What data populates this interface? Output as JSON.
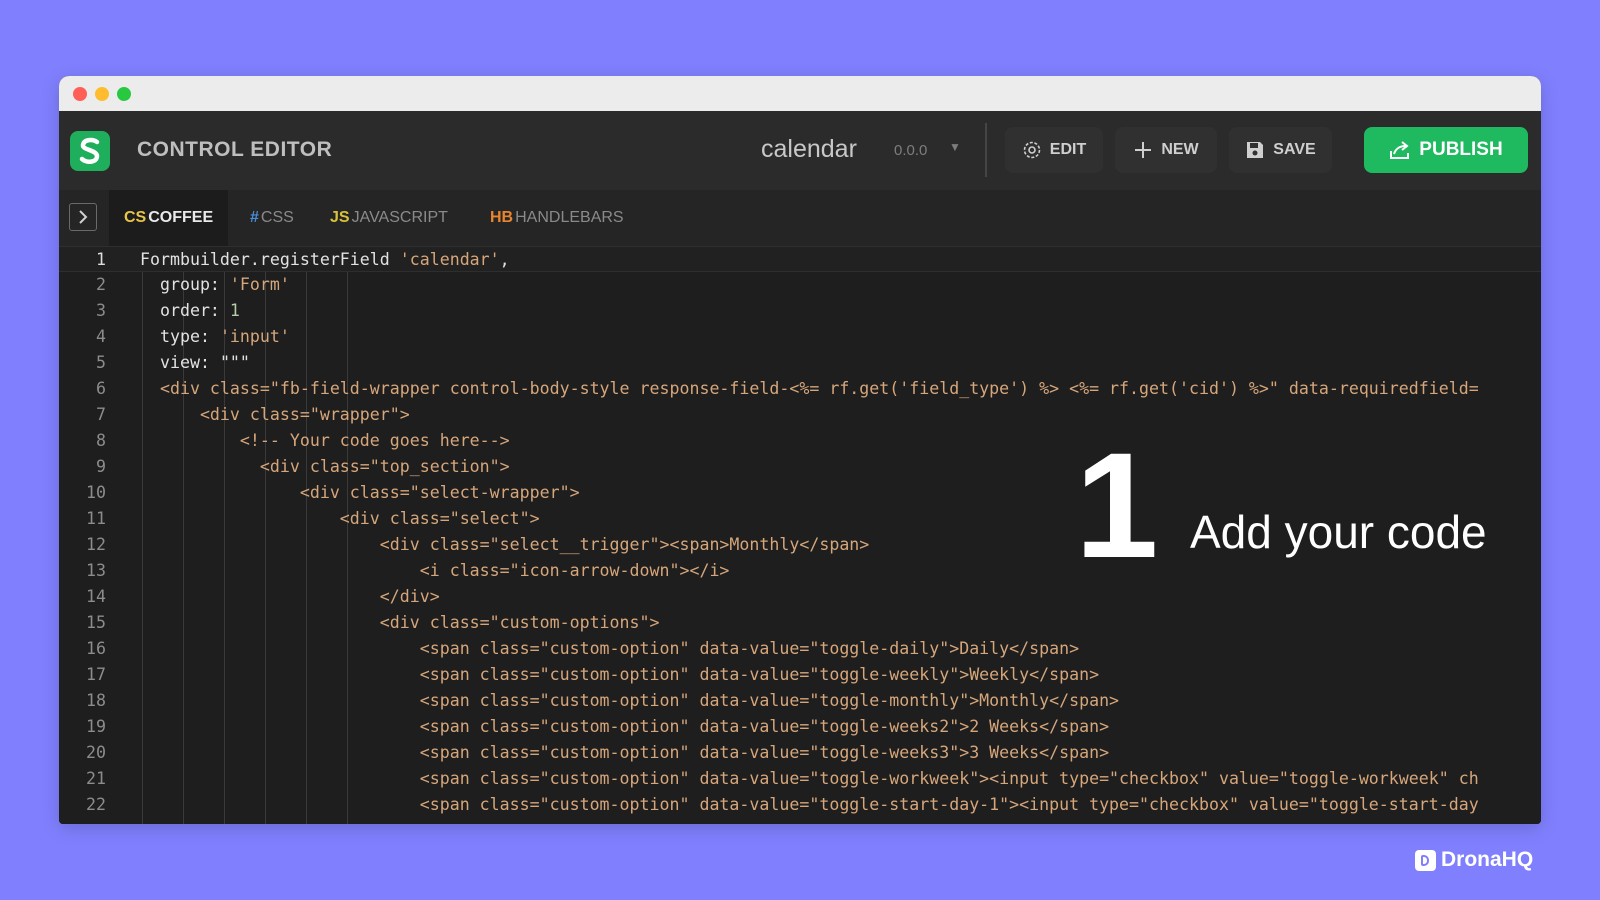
{
  "header": {
    "app_title": "CONTROL EDITOR",
    "control_name": "calendar",
    "version": "0.0.0",
    "buttons": {
      "edit": "EDIT",
      "new": "NEW",
      "save": "SAVE",
      "publish": "PUBLISH"
    }
  },
  "tabs": [
    {
      "prefix": "CS",
      "label": "COFFEE",
      "color": "#e8c547",
      "active": true
    },
    {
      "prefix": "#",
      "label": "CSS",
      "color": "#4a8fd6",
      "active": false
    },
    {
      "prefix": "JS",
      "label": "JAVASCRIPT",
      "color": "#d9c23a",
      "active": false
    },
    {
      "prefix": "HB",
      "label": "HANDLEBARS",
      "color": "#e8852e",
      "active": false
    }
  ],
  "editor": {
    "lines": [
      {
        "n": "1",
        "segments": [
          [
            "Formbuilder.registerField ",
            "plain"
          ],
          [
            "'calendar'",
            "str"
          ],
          [
            ",",
            "plain"
          ]
        ]
      },
      {
        "n": "2",
        "segments": [
          [
            "  group: ",
            "plain"
          ],
          [
            "'Form'",
            "str"
          ]
        ]
      },
      {
        "n": "3",
        "segments": [
          [
            "  order: ",
            "plain"
          ],
          [
            "1",
            "num"
          ]
        ]
      },
      {
        "n": "4",
        "segments": [
          [
            "  type: ",
            "plain"
          ],
          [
            "'input'",
            "str"
          ]
        ]
      },
      {
        "n": "5",
        "segments": [
          [
            "  view: ",
            "plain"
          ],
          [
            "\"\"\"",
            "plain"
          ]
        ]
      },
      {
        "n": "6",
        "segments": [
          [
            "  <div class=\"fb-field-wrapper control-body-style response-field-<%= rf.get('field_type') %> <%= rf.get('cid') %>\" data-requiredfield=",
            "str"
          ]
        ]
      },
      {
        "n": "7",
        "segments": [
          [
            "      <div class=\"wrapper\">",
            "str"
          ]
        ]
      },
      {
        "n": "8",
        "segments": [
          [
            "          <!-- Your code goes here-->",
            "str"
          ]
        ]
      },
      {
        "n": "9",
        "segments": [
          [
            "            <div class=\"top_section\">",
            "str"
          ]
        ]
      },
      {
        "n": "10",
        "segments": [
          [
            "                <div class=\"select-wrapper\">",
            "str"
          ]
        ]
      },
      {
        "n": "11",
        "segments": [
          [
            "                    <div class=\"select\">",
            "str"
          ]
        ]
      },
      {
        "n": "12",
        "segments": [
          [
            "                        <div class=\"select__trigger\"><span>Monthly</span>",
            "str"
          ]
        ]
      },
      {
        "n": "13",
        "segments": [
          [
            "                            <i class=\"icon-arrow-down\"></i>",
            "str"
          ]
        ]
      },
      {
        "n": "14",
        "segments": [
          [
            "                        </div>",
            "str"
          ]
        ]
      },
      {
        "n": "15",
        "segments": [
          [
            "                        <div class=\"custom-options\">",
            "str"
          ]
        ]
      },
      {
        "n": "16",
        "segments": [
          [
            "                            <span class=\"custom-option\" data-value=\"toggle-daily\">Daily</span>",
            "str"
          ]
        ]
      },
      {
        "n": "17",
        "segments": [
          [
            "                            <span class=\"custom-option\" data-value=\"toggle-weekly\">Weekly</span>",
            "str"
          ]
        ]
      },
      {
        "n": "18",
        "segments": [
          [
            "                            <span class=\"custom-option\" data-value=\"toggle-monthly\">Monthly</span>",
            "str"
          ]
        ]
      },
      {
        "n": "19",
        "segments": [
          [
            "                            <span class=\"custom-option\" data-value=\"toggle-weeks2\">2 Weeks</span>",
            "str"
          ]
        ]
      },
      {
        "n": "20",
        "segments": [
          [
            "                            <span class=\"custom-option\" data-value=\"toggle-weeks3\">3 Weeks</span>",
            "str"
          ]
        ]
      },
      {
        "n": "21",
        "segments": [
          [
            "                            <span class=\"custom-option\" data-value=\"toggle-workweek\"><input type=\"checkbox\" value=\"toggle-workweek\" ch",
            "str"
          ]
        ]
      },
      {
        "n": "22",
        "segments": [
          [
            "                            <span class=\"custom-option\" data-value=\"toggle-start-day-1\"><input type=\"checkbox\" value=\"toggle-start-day",
            "str"
          ]
        ]
      }
    ]
  },
  "annotation": {
    "step_number": "1",
    "text": "Add your code"
  },
  "brand": {
    "name": "DronaHQ"
  },
  "colors": {
    "background": "#8080ff",
    "accent": "#1fb95f",
    "editor_bg": "#1e1e1e"
  }
}
